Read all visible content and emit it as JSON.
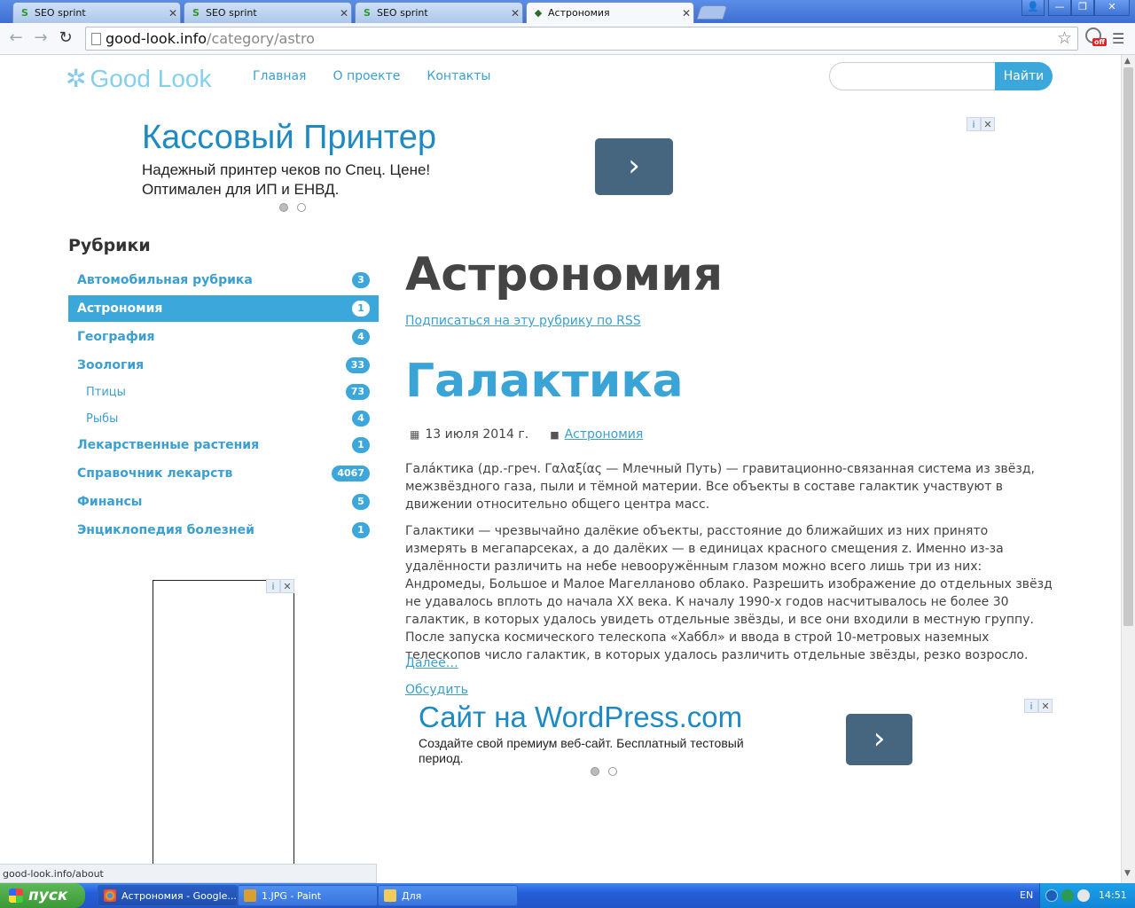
{
  "browser": {
    "tabs": [
      {
        "title": "SEO sprint",
        "active": false
      },
      {
        "title": "SEO sprint",
        "active": false
      },
      {
        "title": "SEO sprint",
        "active": false
      },
      {
        "title": "Астрономия",
        "active": true
      }
    ],
    "close_glyph": "✕",
    "url_host": "good-look.info",
    "url_path": "/category/astro",
    "status_url": "good-look.info/about",
    "ext_badge": "off"
  },
  "site": {
    "logo": "Good Look",
    "nav": [
      "Главная",
      "О проекте",
      "Контакты"
    ],
    "search_button": "Найти",
    "search_placeholder": ""
  },
  "ad_top": {
    "title": "Кассовый Принтер",
    "line1": "Надежный принтер чеков по Спец. Цене!",
    "line2": "Оптимален для ИП и ЕНВД."
  },
  "sidebar": {
    "title": "Рубрики",
    "categories": [
      {
        "label": "Автомобильная рубрика",
        "count": "3",
        "sub": false,
        "active": false
      },
      {
        "label": "Астрономия",
        "count": "1",
        "sub": false,
        "active": true
      },
      {
        "label": "География",
        "count": "4",
        "sub": false,
        "active": false
      },
      {
        "label": "Зоология",
        "count": "33",
        "sub": false,
        "active": false
      },
      {
        "label": "Птицы",
        "count": "73",
        "sub": true,
        "active": false
      },
      {
        "label": "Рыбы",
        "count": "4",
        "sub": true,
        "active": false
      },
      {
        "label": "Лекарственные растения",
        "count": "1",
        "sub": false,
        "active": false
      },
      {
        "label": "Справочник лекарств",
        "count": "4067",
        "sub": false,
        "active": false
      },
      {
        "label": "Финансы",
        "count": "5",
        "sub": false,
        "active": false
      },
      {
        "label": "Энциклопедия болезней",
        "count": "1",
        "sub": false,
        "active": false
      }
    ]
  },
  "main": {
    "page_title": "Астрономия",
    "rss": "Подписаться на эту рубрику по RSS",
    "post_title": "Галактика",
    "date": "13 июля 2014 г.",
    "category": "Астрономия",
    "para1": "Гала́ктика (др.-греч. Γαλαξίας — Млечный Путь) — гравитационно-связанная система из звёзд, межзвёздного газа, пыли и тёмной материи. Все объекты в составе галактик участвуют в движении относительно общего центра масс.",
    "para2": "Галактики — чрезвычайно далёкие объекты, расстояние до ближайших из них принято измерять в мегапарсеках, а до далёких — в единицах красного смещения z. Именно из-за удалённости различить на небе невооружённым глазом можно всего лишь три из них: Андромеды, Большое и Малое Магелланово облако. Разрешить изображение до отдельных звёзд не удавалось вплоть до начала XX века. К началу 1990-х годов насчитывалось не более 30 галактик, в которых удалось увидеть отдельные звёзды, и все они входили в местную группу. После запуска космического телескопа «Хаббл» и ввода в строй 10-метровых наземных телескопов число галактик, в которых удалось различить отдельные звёзды, резко возросло.",
    "more": "Далее…",
    "discuss": "Обсудить"
  },
  "ad_bottom": {
    "title": "Сайт на WordPress.com",
    "line1": "Создайте свой премиум веб-сайт. Бесплатный тестовый",
    "line2": "период."
  },
  "taskbar": {
    "start": "пуск",
    "tasks": [
      {
        "label": "Астрономия - Google...",
        "active": true,
        "icon_color": "#e8b400"
      },
      {
        "label": "1.JPG - Paint",
        "active": false,
        "icon_color": "#d9a030"
      },
      {
        "label": "Для",
        "active": false,
        "icon_color": "#f2cc5a"
      }
    ],
    "lang": "EN",
    "time": "14:51"
  },
  "colors": {
    "accent": "#3ca7da",
    "link": "#3b9fd0",
    "ad_title": "#1e8ac4"
  }
}
